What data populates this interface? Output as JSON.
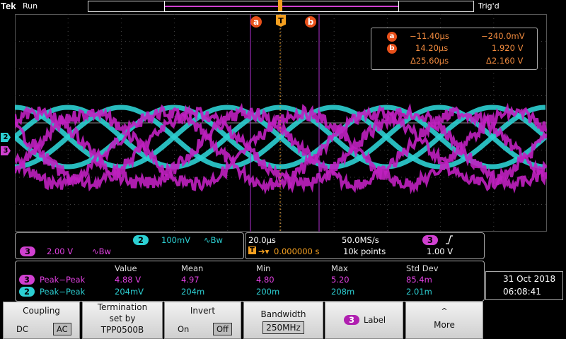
{
  "header": {
    "brand": "Tek",
    "state": "Run",
    "trigger_status": "Trig'd",
    "trigger_mark": "T"
  },
  "cursors": {
    "a_label": "a",
    "b_label": "b",
    "color": "#e8501a",
    "readout": {
      "a_time": "−11.40µs",
      "a_value": "−240.0mV",
      "b_time": "14.20µs",
      "b_value": "1.920 V",
      "delta_time": "Δ25.60µs",
      "delta_value": "Δ2.160 V"
    }
  },
  "channels": {
    "ch2": {
      "number": "2",
      "color": "#2ccfd2",
      "scale": "100mV",
      "bw_symbol": "∿Bw"
    },
    "ch3": {
      "number": "3",
      "color": "#c020c0",
      "scale": "2.00 V",
      "bw_symbol": "∿Bw"
    }
  },
  "horizontal": {
    "scale": "20.0µs",
    "sample_rate": "50.0MS/s",
    "trigger_offset": "0.000000 s",
    "record_length": "10k points"
  },
  "trigger": {
    "source": "3",
    "slope_icon": "rising-edge-icon",
    "level": "1.00 V"
  },
  "measurements": {
    "headers": [
      "Value",
      "Mean",
      "Min",
      "Max",
      "Std Dev"
    ],
    "rows": [
      {
        "channel": "3",
        "name": "Peak−Peak",
        "value": "4.88 V",
        "mean": "4.97",
        "min": "4.80",
        "max": "5.20",
        "std_dev": "85.4m"
      },
      {
        "channel": "2",
        "name": "Peak−Peak",
        "value": "204mV",
        "mean": "204m",
        "min": "200m",
        "max": "208m",
        "std_dev": "2.01m"
      }
    ]
  },
  "datetime": {
    "date": "31 Oct  2018",
    "time": "06:08:41"
  },
  "softkeys": {
    "coupling": {
      "title": "Coupling",
      "opt1": "DC",
      "opt2": "AC"
    },
    "termination": {
      "line1": "Termination",
      "line2": "set by",
      "line3": "TPP0500B"
    },
    "invert": {
      "title": "Invert",
      "opt1": "On",
      "opt2": "Off"
    },
    "bandwidth": {
      "title": "Bandwidth",
      "value": "250MHz"
    },
    "label": {
      "channel": "3",
      "text": "Label"
    },
    "more": {
      "text": "More"
    }
  }
}
